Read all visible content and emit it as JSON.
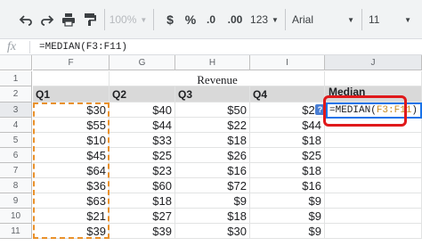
{
  "toolbar": {
    "zoom": "100%",
    "currency": "$",
    "percent": "%",
    "decimal_decrease": ".0",
    "decimal_increase": ".00",
    "format_more": "123",
    "font": "Arial",
    "font_size": "11"
  },
  "formula_bar": {
    "fx": "fx",
    "value": "=MEDIAN(F3:F11)"
  },
  "columns": [
    "F",
    "G",
    "H",
    "I",
    "J"
  ],
  "rows": [
    "1",
    "2",
    "3",
    "4",
    "5",
    "6",
    "7",
    "8",
    "9",
    "10",
    "11"
  ],
  "sheet": {
    "title": "Revenue",
    "headers": [
      "Q1",
      "Q2",
      "Q3",
      "Q4",
      "Median"
    ],
    "data": [
      [
        "$30",
        "$40",
        "$50",
        "$20"
      ],
      [
        "$55",
        "$44",
        "$22",
        "$44"
      ],
      [
        "$10",
        "$33",
        "$18",
        "$18"
      ],
      [
        "$45",
        "$25",
        "$26",
        "$25"
      ],
      [
        "$64",
        "$23",
        "$16",
        "$18"
      ],
      [
        "$36",
        "$60",
        "$72",
        "$16"
      ],
      [
        "$63",
        "$18",
        "$9",
        "$9"
      ],
      [
        "$21",
        "$27",
        "$18",
        "$9"
      ],
      [
        "$39",
        "$39",
        "$30",
        "$9"
      ]
    ]
  },
  "edit": {
    "func": "=MEDIAN(",
    "ref": "F3:F11",
    "close": ")"
  },
  "help_badge": "?"
}
